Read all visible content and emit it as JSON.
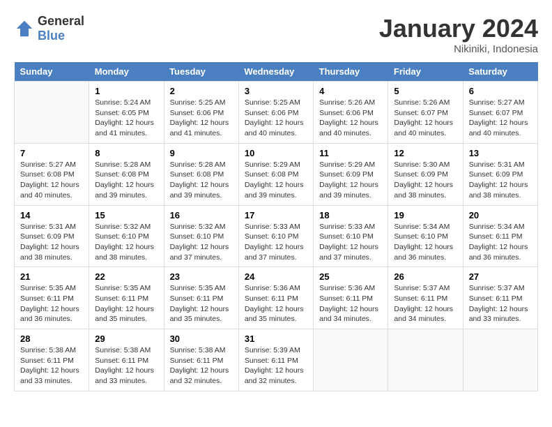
{
  "header": {
    "logo_general": "General",
    "logo_blue": "Blue",
    "month_year": "January 2024",
    "location": "Nikiniki, Indonesia"
  },
  "days_of_week": [
    "Sunday",
    "Monday",
    "Tuesday",
    "Wednesday",
    "Thursday",
    "Friday",
    "Saturday"
  ],
  "weeks": [
    [
      {
        "day": "",
        "sunrise": "",
        "sunset": "",
        "daylight": "",
        "empty": true
      },
      {
        "day": "1",
        "sunrise": "Sunrise: 5:24 AM",
        "sunset": "Sunset: 6:05 PM",
        "daylight": "Daylight: 12 hours and 41 minutes."
      },
      {
        "day": "2",
        "sunrise": "Sunrise: 5:25 AM",
        "sunset": "Sunset: 6:06 PM",
        "daylight": "Daylight: 12 hours and 41 minutes."
      },
      {
        "day": "3",
        "sunrise": "Sunrise: 5:25 AM",
        "sunset": "Sunset: 6:06 PM",
        "daylight": "Daylight: 12 hours and 40 minutes."
      },
      {
        "day": "4",
        "sunrise": "Sunrise: 5:26 AM",
        "sunset": "Sunset: 6:06 PM",
        "daylight": "Daylight: 12 hours and 40 minutes."
      },
      {
        "day": "5",
        "sunrise": "Sunrise: 5:26 AM",
        "sunset": "Sunset: 6:07 PM",
        "daylight": "Daylight: 12 hours and 40 minutes."
      },
      {
        "day": "6",
        "sunrise": "Sunrise: 5:27 AM",
        "sunset": "Sunset: 6:07 PM",
        "daylight": "Daylight: 12 hours and 40 minutes."
      }
    ],
    [
      {
        "day": "7",
        "sunrise": "Sunrise: 5:27 AM",
        "sunset": "Sunset: 6:08 PM",
        "daylight": "Daylight: 12 hours and 40 minutes."
      },
      {
        "day": "8",
        "sunrise": "Sunrise: 5:28 AM",
        "sunset": "Sunset: 6:08 PM",
        "daylight": "Daylight: 12 hours and 39 minutes."
      },
      {
        "day": "9",
        "sunrise": "Sunrise: 5:28 AM",
        "sunset": "Sunset: 6:08 PM",
        "daylight": "Daylight: 12 hours and 39 minutes."
      },
      {
        "day": "10",
        "sunrise": "Sunrise: 5:29 AM",
        "sunset": "Sunset: 6:08 PM",
        "daylight": "Daylight: 12 hours and 39 minutes."
      },
      {
        "day": "11",
        "sunrise": "Sunrise: 5:29 AM",
        "sunset": "Sunset: 6:09 PM",
        "daylight": "Daylight: 12 hours and 39 minutes."
      },
      {
        "day": "12",
        "sunrise": "Sunrise: 5:30 AM",
        "sunset": "Sunset: 6:09 PM",
        "daylight": "Daylight: 12 hours and 38 minutes."
      },
      {
        "day": "13",
        "sunrise": "Sunrise: 5:31 AM",
        "sunset": "Sunset: 6:09 PM",
        "daylight": "Daylight: 12 hours and 38 minutes."
      }
    ],
    [
      {
        "day": "14",
        "sunrise": "Sunrise: 5:31 AM",
        "sunset": "Sunset: 6:09 PM",
        "daylight": "Daylight: 12 hours and 38 minutes."
      },
      {
        "day": "15",
        "sunrise": "Sunrise: 5:32 AM",
        "sunset": "Sunset: 6:10 PM",
        "daylight": "Daylight: 12 hours and 38 minutes."
      },
      {
        "day": "16",
        "sunrise": "Sunrise: 5:32 AM",
        "sunset": "Sunset: 6:10 PM",
        "daylight": "Daylight: 12 hours and 37 minutes."
      },
      {
        "day": "17",
        "sunrise": "Sunrise: 5:33 AM",
        "sunset": "Sunset: 6:10 PM",
        "daylight": "Daylight: 12 hours and 37 minutes."
      },
      {
        "day": "18",
        "sunrise": "Sunrise: 5:33 AM",
        "sunset": "Sunset: 6:10 PM",
        "daylight": "Daylight: 12 hours and 37 minutes."
      },
      {
        "day": "19",
        "sunrise": "Sunrise: 5:34 AM",
        "sunset": "Sunset: 6:10 PM",
        "daylight": "Daylight: 12 hours and 36 minutes."
      },
      {
        "day": "20",
        "sunrise": "Sunrise: 5:34 AM",
        "sunset": "Sunset: 6:11 PM",
        "daylight": "Daylight: 12 hours and 36 minutes."
      }
    ],
    [
      {
        "day": "21",
        "sunrise": "Sunrise: 5:35 AM",
        "sunset": "Sunset: 6:11 PM",
        "daylight": "Daylight: 12 hours and 36 minutes."
      },
      {
        "day": "22",
        "sunrise": "Sunrise: 5:35 AM",
        "sunset": "Sunset: 6:11 PM",
        "daylight": "Daylight: 12 hours and 35 minutes."
      },
      {
        "day": "23",
        "sunrise": "Sunrise: 5:35 AM",
        "sunset": "Sunset: 6:11 PM",
        "daylight": "Daylight: 12 hours and 35 minutes."
      },
      {
        "day": "24",
        "sunrise": "Sunrise: 5:36 AM",
        "sunset": "Sunset: 6:11 PM",
        "daylight": "Daylight: 12 hours and 35 minutes."
      },
      {
        "day": "25",
        "sunrise": "Sunrise: 5:36 AM",
        "sunset": "Sunset: 6:11 PM",
        "daylight": "Daylight: 12 hours and 34 minutes."
      },
      {
        "day": "26",
        "sunrise": "Sunrise: 5:37 AM",
        "sunset": "Sunset: 6:11 PM",
        "daylight": "Daylight: 12 hours and 34 minutes."
      },
      {
        "day": "27",
        "sunrise": "Sunrise: 5:37 AM",
        "sunset": "Sunset: 6:11 PM",
        "daylight": "Daylight: 12 hours and 33 minutes."
      }
    ],
    [
      {
        "day": "28",
        "sunrise": "Sunrise: 5:38 AM",
        "sunset": "Sunset: 6:11 PM",
        "daylight": "Daylight: 12 hours and 33 minutes."
      },
      {
        "day": "29",
        "sunrise": "Sunrise: 5:38 AM",
        "sunset": "Sunset: 6:11 PM",
        "daylight": "Daylight: 12 hours and 33 minutes."
      },
      {
        "day": "30",
        "sunrise": "Sunrise: 5:38 AM",
        "sunset": "Sunset: 6:11 PM",
        "daylight": "Daylight: 12 hours and 32 minutes."
      },
      {
        "day": "31",
        "sunrise": "Sunrise: 5:39 AM",
        "sunset": "Sunset: 6:11 PM",
        "daylight": "Daylight: 12 hours and 32 minutes."
      },
      {
        "day": "",
        "sunrise": "",
        "sunset": "",
        "daylight": "",
        "empty": true
      },
      {
        "day": "",
        "sunrise": "",
        "sunset": "",
        "daylight": "",
        "empty": true
      },
      {
        "day": "",
        "sunrise": "",
        "sunset": "",
        "daylight": "",
        "empty": true
      }
    ]
  ]
}
